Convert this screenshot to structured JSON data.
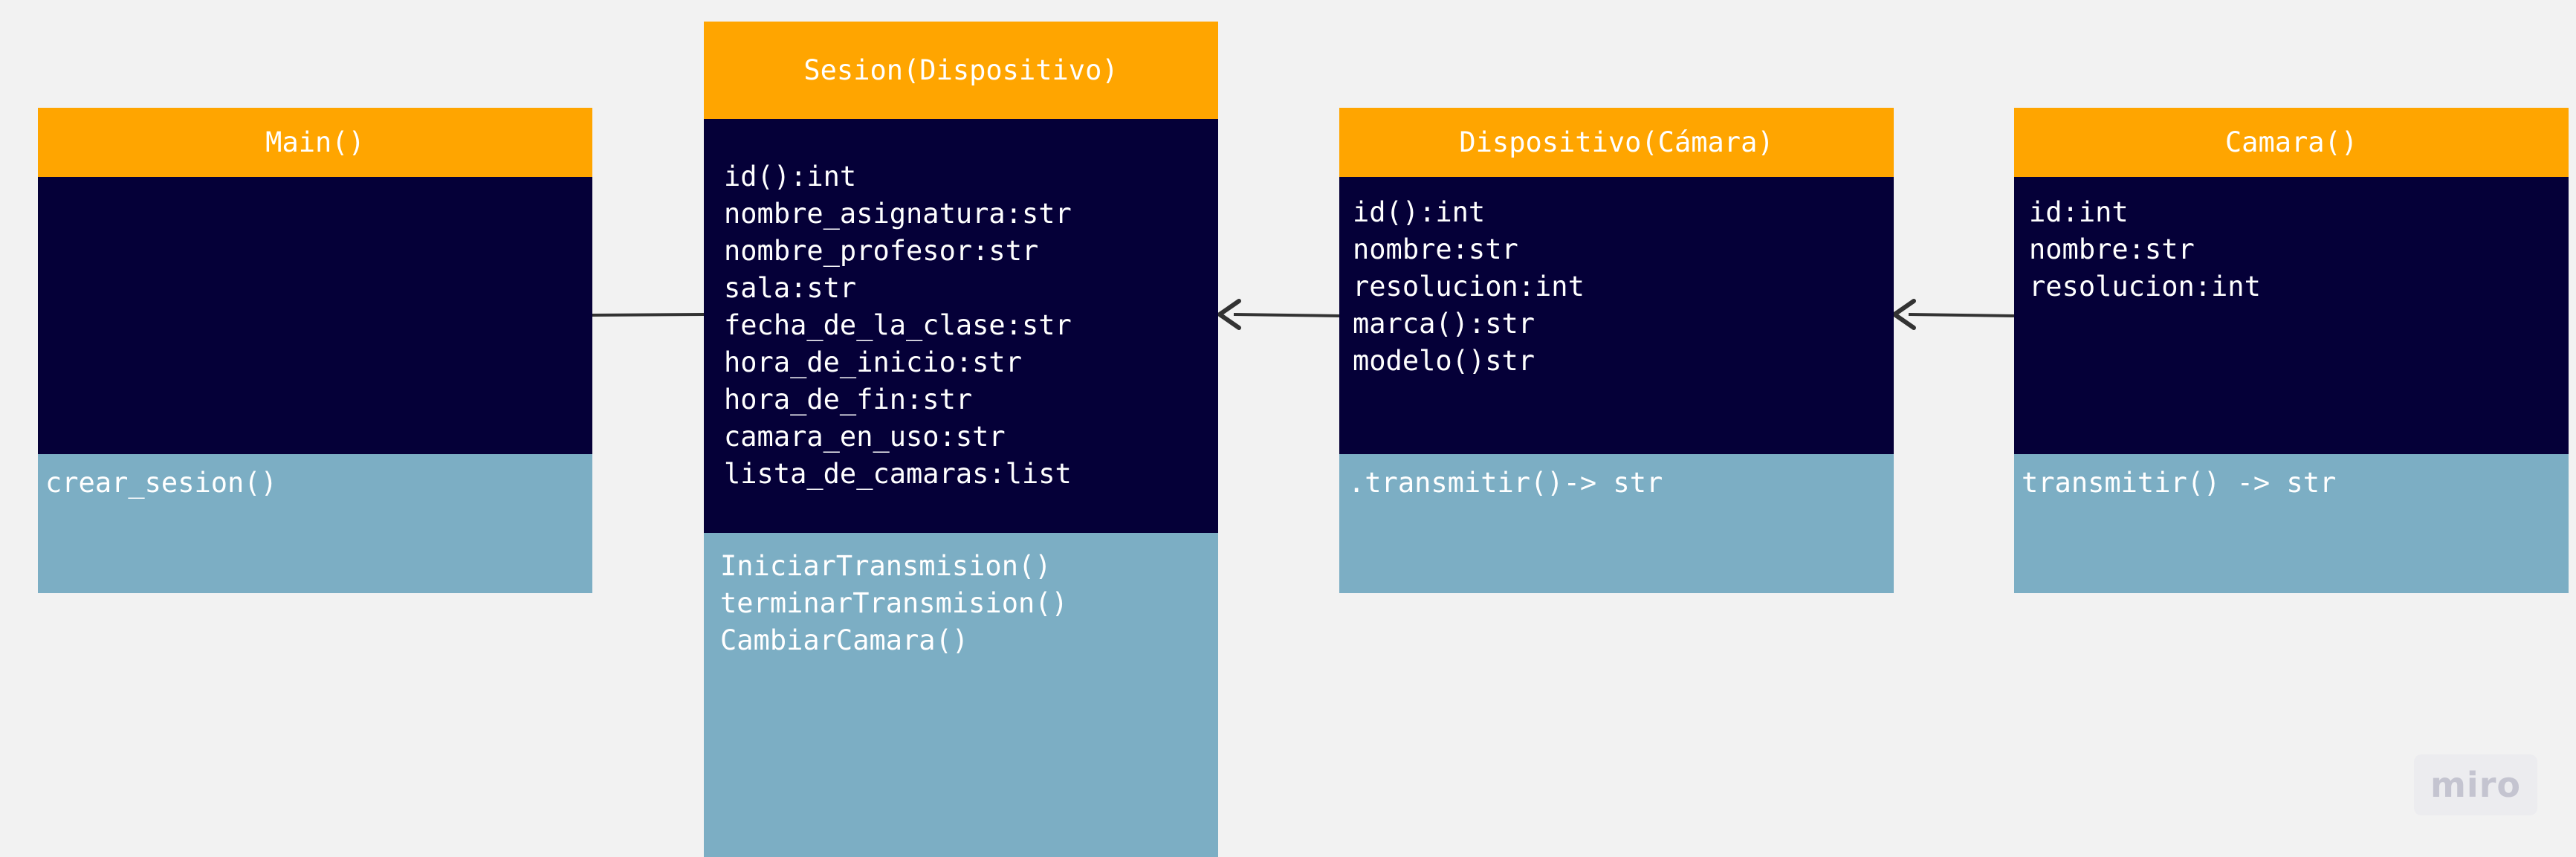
{
  "classes": {
    "main": {
      "name": "Main()",
      "attributes": [],
      "methods": [
        "crear_sesion()"
      ]
    },
    "sesion": {
      "name": "Sesion(Dispositivo)",
      "attributes": [
        "id():int",
        "nombre_asignatura:str",
        "nombre_profesor:str",
        "sala:str",
        "fecha_de_la_clase:str",
        "hora_de_inicio:str",
        "hora_de_fin:str",
        "camara_en_uso:str",
        "lista_de_camaras:list"
      ],
      "methods": [
        "IniciarTransmision()",
        "terminarTransmision()",
        "CambiarCamara()"
      ]
    },
    "dispositivo": {
      "name": "Dispositivo(Cámara)",
      "attributes": [
        "id():int",
        "nombre:str",
        "resolucion:int",
        "marca():str",
        "modelo()str"
      ],
      "methods": [
        ".transmitir()-> str"
      ]
    },
    "camara": {
      "name": "Camara()",
      "attributes": [
        "id:int",
        "nombre:str",
        "resolucion:int"
      ],
      "methods": [
        "transmitir() -> str"
      ]
    }
  },
  "watermark": "miro",
  "colors": {
    "header": "#ffa500",
    "attributes_bg": "#050038",
    "methods_bg": "#7caec4",
    "canvas_bg": "#f2f2f2",
    "connector": "#333333"
  }
}
